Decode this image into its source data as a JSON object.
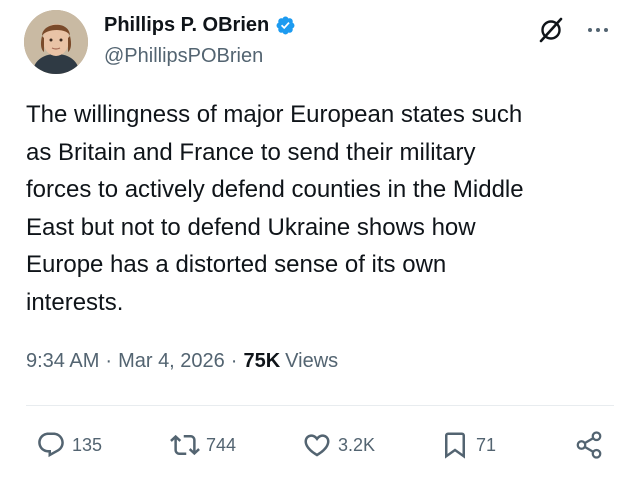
{
  "author": {
    "name": "Phillips P. OBrien",
    "handle": "@PhillipsPOBrien"
  },
  "tweet": {
    "text": "The willingness of major European states such\nas Britain and France to send their military\nforces to actively defend counties in the Middle\nEast but not to defend Ukraine shows how\nEurope has a distorted sense of its own\ninterests."
  },
  "meta": {
    "time": "9:34 AM",
    "sep1": "·",
    "date": "Mar 4, 2026",
    "sep2": "·",
    "views_count": "75K",
    "views_label": "Views"
  },
  "actions": {
    "replies": "135",
    "reposts": "744",
    "likes": "3.2K",
    "bookmarks": "71"
  },
  "icons": [
    "verified-badge-icon",
    "grok-icon",
    "more-icon",
    "reply-icon",
    "repost-icon",
    "like-icon",
    "bookmark-icon",
    "share-icon"
  ],
  "colors": {
    "verified": "#1d9bf0",
    "muted": "#536471",
    "text": "#0f1419",
    "icon": "#536471"
  }
}
